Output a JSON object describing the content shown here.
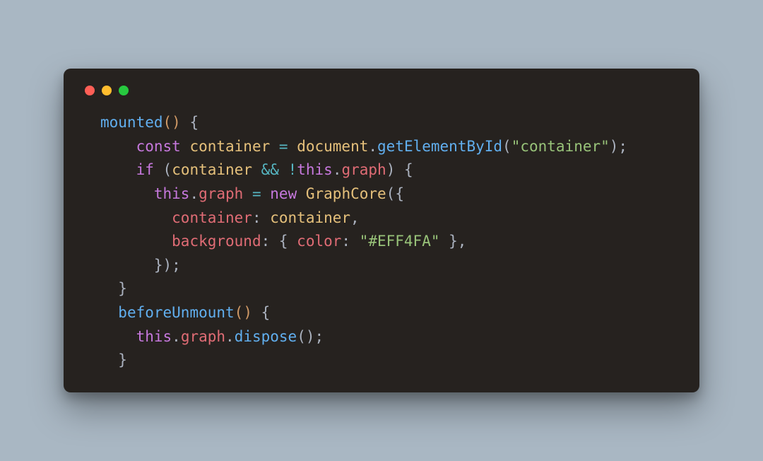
{
  "window": {
    "traffic_light_colors": {
      "red": "#ff5f56",
      "yellow": "#ffbd2e",
      "green": "#27c93f"
    }
  },
  "code": {
    "line1_mounted": "mounted",
    "line1_paren_open": "(",
    "line1_paren_close": ")",
    "line1_brace": " {",
    "line2_indent": "    ",
    "line2_const": "const",
    "line2_sp1": " ",
    "line2_container": "container",
    "line2_sp2": " ",
    "line2_eq": "=",
    "line2_sp3": " ",
    "line2_document": "document",
    "line2_dot": ".",
    "line2_getElementById": "getElementById",
    "line2_paren_open": "(",
    "line2_str": "\"container\"",
    "line2_tail": ");",
    "line3_indent": "    ",
    "line3_if": "if",
    "line3_sp1": " ",
    "line3_po": "(",
    "line3_container": "container",
    "line3_sp2": " ",
    "line3_and": "&&",
    "line3_sp3": " ",
    "line3_not": "!",
    "line3_this": "this",
    "line3_dot": ".",
    "line3_graph": "graph",
    "line3_pc": ")",
    "line3_brace": " {",
    "line4_indent": "      ",
    "line4_this": "this",
    "line4_dot": ".",
    "line4_graph": "graph",
    "line4_sp1": " ",
    "line4_eq": "=",
    "line4_sp2": " ",
    "line4_new": "new",
    "line4_sp3": " ",
    "line4_GraphCore": "GraphCore",
    "line4_tail": "({",
    "line5_indent": "        ",
    "line5_key": "container",
    "line5_colon": ": ",
    "line5_val": "container",
    "line5_comma": ",",
    "line6_indent": "        ",
    "line6_key": "background",
    "line6_colon": ": { ",
    "line6_color_key": "color",
    "line6_color_colon": ": ",
    "line6_str": "\"#EFF4FA\"",
    "line6_tail": " },",
    "line7": "      });",
    "line8": "  }",
    "line9_indent": "  ",
    "line9_beforeUnmount": "beforeUnmount",
    "line9_po": "(",
    "line9_pc": ")",
    "line9_brace": " {",
    "line10_indent": "    ",
    "line10_this": "this",
    "line10_dot1": ".",
    "line10_graph": "graph",
    "line10_dot2": ".",
    "line10_dispose": "dispose",
    "line10_tail": "();",
    "line11": "  }"
  }
}
